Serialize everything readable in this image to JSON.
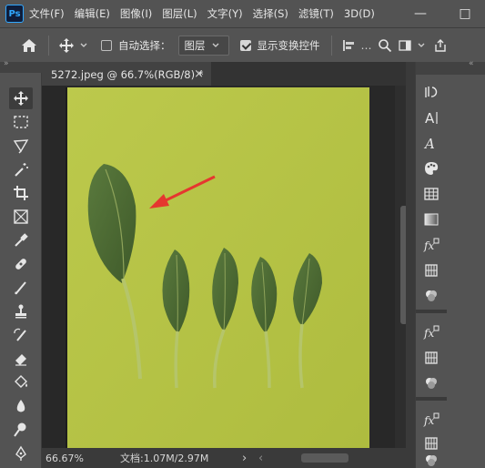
{
  "app": {
    "logo": "Ps"
  },
  "menu": [
    "文件(F)",
    "编辑(E)",
    "图像(I)",
    "图层(L)",
    "文字(Y)",
    "选择(S)",
    "滤镜(T)",
    "3D(D)"
  ],
  "window_controls": {
    "minimize": "—",
    "maximize": "□"
  },
  "options": {
    "auto_select_label": "自动选择：",
    "auto_select_checked": false,
    "auto_select_target": "图层",
    "show_transform_label": "显示变换控件",
    "show_transform_checked": true
  },
  "document": {
    "tab_title": "5272.jpeg @ 66.7%(RGB/8) *",
    "tab_close": "×"
  },
  "status": {
    "zoom": "66.67%",
    "doc_size": "文档:1.07M/2.97M",
    "arrow_right": "›",
    "arrow_left": "‹"
  },
  "toolbar_tools": [
    "move-tool",
    "marquee-tool",
    "lasso-tool",
    "magic-wand-tool",
    "crop-tool",
    "frame-tool",
    "eyedropper-tool",
    "healing-tool",
    "brush-tool",
    "stamp-tool",
    "history-brush-tool",
    "eraser-tool",
    "paint-bucket-tool",
    "blur-tool",
    "dodge-tool",
    "pen-tool"
  ],
  "right_panel_icons": [
    "history-icon",
    "character-icon",
    "paragraph-icon",
    "swatches-icon",
    "grid-icon",
    "gradient-icon",
    "fx-icon",
    "adjustment-grid-icon",
    "channels-icon",
    "fx-icon-2",
    "adjustment-grid-icon-2",
    "channels-icon-2",
    "fx-icon-3",
    "adjustment-grid-icon-3",
    "channels-icon-3"
  ],
  "colors": {
    "accent": "#31a8ff",
    "photo_bg": "#b9c64a",
    "leaf": "#4c6b34",
    "arrow": "#e5372f",
    "panel": "#535353",
    "workspace": "#282828"
  }
}
